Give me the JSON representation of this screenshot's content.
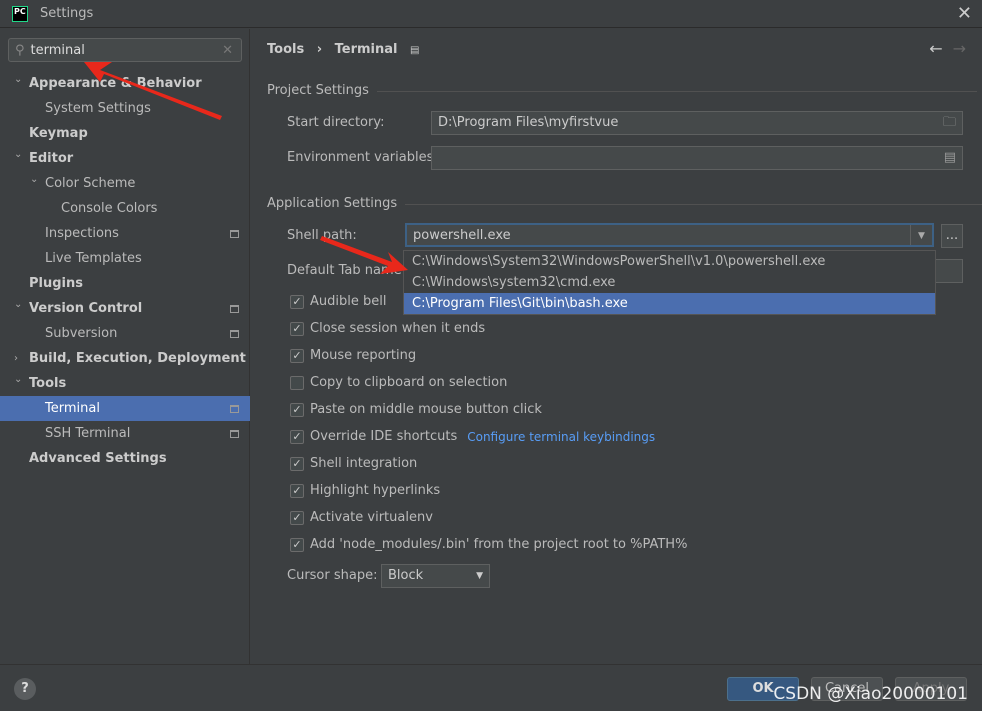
{
  "window": {
    "title": "Settings",
    "logo": "PC"
  },
  "search": {
    "value": "terminal"
  },
  "sidebar": {
    "items": [
      {
        "label": "Appearance & Behavior",
        "level": 0,
        "bold": true,
        "chevron": "down"
      },
      {
        "label": "System Settings",
        "level": 1
      },
      {
        "label": "Keymap",
        "level": 0,
        "bold": true
      },
      {
        "label": "Editor",
        "level": 0,
        "bold": true,
        "chevron": "down"
      },
      {
        "label": "Color Scheme",
        "level": 1,
        "chevron": "down"
      },
      {
        "label": "Console Colors",
        "level": 2
      },
      {
        "label": "Inspections",
        "level": 1,
        "page": true
      },
      {
        "label": "Live Templates",
        "level": 1
      },
      {
        "label": "Plugins",
        "level": 0,
        "bold": true
      },
      {
        "label": "Version Control",
        "level": 0,
        "bold": true,
        "page": true,
        "chevron": "down"
      },
      {
        "label": "Subversion",
        "level": 1,
        "page": true
      },
      {
        "label": "Build, Execution, Deployment",
        "level": 0,
        "bold": true,
        "chevron": "right"
      },
      {
        "label": "Tools",
        "level": 0,
        "bold": true,
        "chevron": "down"
      },
      {
        "label": "Terminal",
        "level": 1,
        "page": true,
        "selected": true
      },
      {
        "label": "SSH Terminal",
        "level": 1,
        "page": true
      },
      {
        "label": "Advanced Settings",
        "level": 0,
        "bold": true
      }
    ]
  },
  "breadcrumb": {
    "parent": "Tools",
    "sep": "›",
    "current": "Terminal"
  },
  "project": {
    "title": "Project Settings",
    "start_dir_label": "Start directory:",
    "start_dir": "D:\\Program Files\\myfirstvue",
    "env_label": "Environment variables:",
    "env": ""
  },
  "app": {
    "title": "Application Settings",
    "shell_label": "Shell path:",
    "shell": "powershell.exe",
    "browse": "...",
    "tab_label": "Default Tab name:",
    "options": [
      "C:\\Windows\\System32\\WindowsPowerShell\\v1.0\\powershell.exe",
      "C:\\Windows\\system32\\cmd.exe",
      "C:\\Program Files\\Git\\bin\\bash.exe"
    ],
    "checkboxes": [
      {
        "label": "Audible bell",
        "checked": true
      },
      {
        "label": "Close session when it ends",
        "checked": true
      },
      {
        "label": "Mouse reporting",
        "checked": true
      },
      {
        "label": "Copy to clipboard on selection",
        "checked": false
      },
      {
        "label": "Paste on middle mouse button click",
        "checked": true
      },
      {
        "label": "Override IDE shortcuts",
        "checked": true,
        "link": "Configure terminal keybindings"
      },
      {
        "label": "Shell integration",
        "checked": true
      },
      {
        "label": "Highlight hyperlinks",
        "checked": true
      },
      {
        "label": "Activate virtualenv",
        "checked": true
      },
      {
        "label": "Add 'node_modules/.bin' from the project root to %PATH%",
        "checked": true
      }
    ],
    "cursor_label": "Cursor shape:",
    "cursor": "Block"
  },
  "footer": {
    "help": "?",
    "ok": "OK",
    "cancel": "Cancel",
    "apply": "Apply"
  },
  "watermark": "CSDN @Xiao20000101",
  "colors": {
    "selection": "#4b6eaf",
    "arrow": "#e8281b"
  }
}
